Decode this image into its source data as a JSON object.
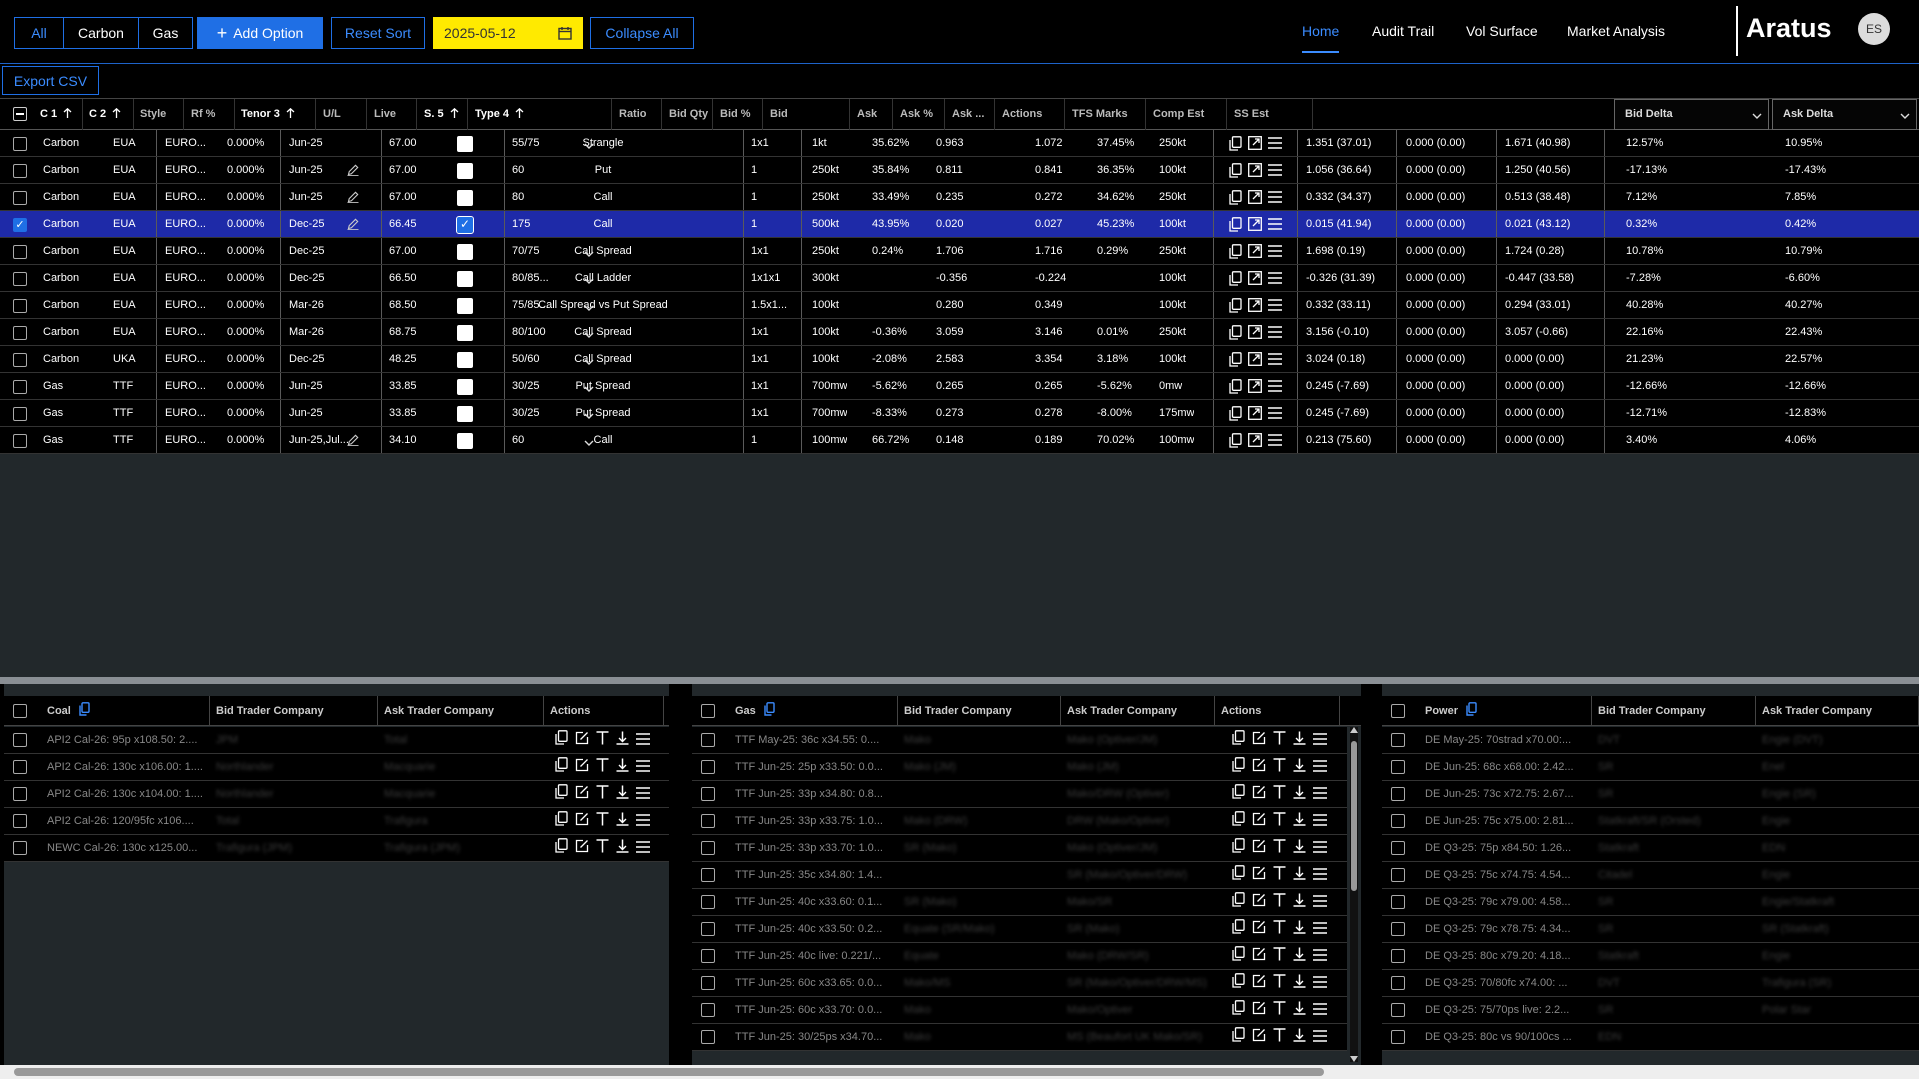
{
  "filters": {
    "all": "All",
    "carbon": "Carbon",
    "gas": "Gas"
  },
  "toolbar": {
    "add_option": "Add Option",
    "reset_sort": "Reset Sort",
    "date": "2025-05-12",
    "collapse_all": "Collapse All",
    "export_csv": "Export CSV"
  },
  "nav": {
    "home": "Home",
    "audit_trail": "Audit Trail",
    "vol_surface": "Vol Surface",
    "market_analysis": "Market Analysis"
  },
  "brand": "Aratus",
  "avatar": "ES",
  "colors": {
    "accent": "#1f6fe5",
    "date_bg": "#ffea00",
    "selected_row": "#1e2aa8"
  },
  "icons": {
    "plus": "plus-icon",
    "calendar": "calendar-icon",
    "sort_up": "arrow-up-icon",
    "chevron": "chevron-down-icon",
    "pencil": "pencil-icon",
    "copy": "copy-icon",
    "expand": "expand-icon",
    "menu": "menu-icon",
    "edit": "edit-icon",
    "top": "align-top-icon",
    "download": "download-icon"
  },
  "grid": {
    "headers": {
      "c1": "C 1",
      "c2": "C 2",
      "style": "Style",
      "rf": "Rf %",
      "tenor": "Tenor 3",
      "ul": "U/L",
      "live": "Live",
      "s": "S. 5",
      "type": "Type 4",
      "ratio": "Ratio",
      "bid_qty": "Bid Qty",
      "bid_pct": "Bid %",
      "bid": "Bid",
      "ask": "Ask",
      "ask_pct": "Ask %",
      "ask_qty": "Ask ...",
      "actions": "Actions",
      "tfs": "TFS Marks",
      "comp": "Comp Est",
      "ss": "SS Est",
      "bid_delta": "Bid Delta",
      "ask_delta": "Ask Delta"
    },
    "rows": [
      {
        "selected": false,
        "c1": "Carbon",
        "c2": "EUA",
        "style": "EURO...",
        "rf": "0.000%",
        "tenor": "Jun-25",
        "edit": false,
        "ul": "67.00",
        "live": false,
        "s": "55/75",
        "chev": true,
        "type": "Strangle",
        "ratio": "1x1",
        "bid_qty": "1kt",
        "bid_pct": "35.62%",
        "bid": "0.963",
        "ask": "1.072",
        "ask_pct": "37.45%",
        "ask_qty": "250kt",
        "tfs": "1.351 (37.01)",
        "comp": "0.000 (0.00)",
        "ss": "1.671 (40.98)",
        "bid_delta": "12.57%",
        "ask_delta": "10.95%"
      },
      {
        "selected": false,
        "c1": "Carbon",
        "c2": "EUA",
        "style": "EURO...",
        "rf": "0.000%",
        "tenor": "Jun-25",
        "edit": true,
        "ul": "67.00",
        "live": false,
        "s": "60",
        "chev": false,
        "type": "Put",
        "ratio": "1",
        "bid_qty": "250kt",
        "bid_pct": "35.84%",
        "bid": "0.811",
        "ask": "0.841",
        "ask_pct": "36.35%",
        "ask_qty": "100kt",
        "tfs": "1.056 (36.64)",
        "comp": "0.000 (0.00)",
        "ss": "1.250 (40.56)",
        "bid_delta": "-17.13%",
        "ask_delta": "-17.43%"
      },
      {
        "selected": false,
        "c1": "Carbon",
        "c2": "EUA",
        "style": "EURO...",
        "rf": "0.000%",
        "tenor": "Jun-25",
        "edit": true,
        "ul": "67.00",
        "live": false,
        "s": "80",
        "chev": false,
        "type": "Call",
        "ratio": "1",
        "bid_qty": "250kt",
        "bid_pct": "33.49%",
        "bid": "0.235",
        "ask": "0.272",
        "ask_pct": "34.62%",
        "ask_qty": "250kt",
        "tfs": "0.332 (34.37)",
        "comp": "0.000 (0.00)",
        "ss": "0.513 (38.48)",
        "bid_delta": "7.12%",
        "ask_delta": "7.85%"
      },
      {
        "selected": true,
        "c1": "Carbon",
        "c2": "EUA",
        "style": "EURO...",
        "rf": "0.000%",
        "tenor": "Dec-25",
        "edit": true,
        "ul": "66.45",
        "live": true,
        "s": "175",
        "chev": false,
        "type": "Call",
        "ratio": "1",
        "bid_qty": "500kt",
        "bid_pct": "43.95%",
        "bid": "0.020",
        "ask": "0.027",
        "ask_pct": "45.23%",
        "ask_qty": "100kt",
        "tfs": "0.015 (41.94)",
        "comp": "0.000 (0.00)",
        "ss": "0.021 (43.12)",
        "bid_delta": "0.32%",
        "ask_delta": "0.42%"
      },
      {
        "selected": false,
        "c1": "Carbon",
        "c2": "EUA",
        "style": "EURO...",
        "rf": "0.000%",
        "tenor": "Dec-25",
        "edit": false,
        "ul": "67.00",
        "live": false,
        "s": "70/75",
        "chev": true,
        "type": "Call Spread",
        "ratio": "1x1",
        "bid_qty": "250kt",
        "bid_pct": "0.24%",
        "bid": "1.706",
        "ask": "1.716",
        "ask_pct": "0.29%",
        "ask_qty": "250kt",
        "tfs": "1.698 (0.19)",
        "comp": "0.000 (0.00)",
        "ss": "1.724 (0.28)",
        "bid_delta": "10.78%",
        "ask_delta": "10.79%"
      },
      {
        "selected": false,
        "c1": "Carbon",
        "c2": "EUA",
        "style": "EURO...",
        "rf": "0.000%",
        "tenor": "Dec-25",
        "edit": false,
        "ul": "66.50",
        "live": false,
        "s": "80/85...",
        "chev": true,
        "type": "Call Ladder",
        "ratio": "1x1x1",
        "bid_qty": "300kt",
        "bid_pct": "",
        "bid": "-0.356",
        "ask": "-0.224",
        "ask_pct": "",
        "ask_qty": "100kt",
        "tfs": "-0.326 (31.39)",
        "comp": "0.000 (0.00)",
        "ss": "-0.447 (33.58)",
        "bid_delta": "-7.28%",
        "ask_delta": "-6.60%"
      },
      {
        "selected": false,
        "c1": "Carbon",
        "c2": "EUA",
        "style": "EURO...",
        "rf": "0.000%",
        "tenor": "Mar-26",
        "edit": false,
        "ul": "68.50",
        "live": false,
        "s": "75/85...",
        "chev": true,
        "type": "Call Spread vs Put Spread",
        "ratio": "1.5x1...",
        "bid_qty": "100kt",
        "bid_pct": "",
        "bid": "0.280",
        "ask": "0.349",
        "ask_pct": "",
        "ask_qty": "100kt",
        "tfs": "0.332 (33.11)",
        "comp": "0.000 (0.00)",
        "ss": "0.294 (33.01)",
        "bid_delta": "40.28%",
        "ask_delta": "40.27%"
      },
      {
        "selected": false,
        "c1": "Carbon",
        "c2": "EUA",
        "style": "EURO...",
        "rf": "0.000%",
        "tenor": "Mar-26",
        "edit": false,
        "ul": "68.75",
        "live": false,
        "s": "80/100",
        "chev": true,
        "type": "Call Spread",
        "ratio": "1x1",
        "bid_qty": "100kt",
        "bid_pct": "-0.36%",
        "bid": "3.059",
        "ask": "3.146",
        "ask_pct": "0.01%",
        "ask_qty": "250kt",
        "tfs": "3.156 (-0.10)",
        "comp": "0.000 (0.00)",
        "ss": "3.057 (-0.66)",
        "bid_delta": "22.16%",
        "ask_delta": "22.43%"
      },
      {
        "selected": false,
        "c1": "Carbon",
        "c2": "UKA",
        "style": "EURO...",
        "rf": "0.000%",
        "tenor": "Dec-25",
        "edit": false,
        "ul": "48.25",
        "live": false,
        "s": "50/60",
        "chev": true,
        "type": "Call Spread",
        "ratio": "1x1",
        "bid_qty": "100kt",
        "bid_pct": "-2.08%",
        "bid": "2.583",
        "ask": "3.354",
        "ask_pct": "3.18%",
        "ask_qty": "100kt",
        "tfs": "3.024 (0.18)",
        "comp": "0.000 (0.00)",
        "ss": "0.000 (0.00)",
        "bid_delta": "21.23%",
        "ask_delta": "22.57%"
      },
      {
        "selected": false,
        "c1": "Gas",
        "c2": "TTF",
        "style": "EURO...",
        "rf": "0.000%",
        "tenor": "Jun-25",
        "edit": false,
        "ul": "33.85",
        "live": false,
        "s": "30/25",
        "chev": true,
        "type": "Put Spread",
        "ratio": "1x1",
        "bid_qty": "700mw",
        "bid_pct": "-5.62%",
        "bid": "0.265",
        "ask": "0.265",
        "ask_pct": "-5.62%",
        "ask_qty": "0mw",
        "tfs": "0.245 (-7.69)",
        "comp": "0.000 (0.00)",
        "ss": "0.000 (0.00)",
        "bid_delta": "-12.66%",
        "ask_delta": "-12.66%"
      },
      {
        "selected": false,
        "c1": "Gas",
        "c2": "TTF",
        "style": "EURO...",
        "rf": "0.000%",
        "tenor": "Jun-25",
        "edit": false,
        "ul": "33.85",
        "live": false,
        "s": "30/25",
        "chev": true,
        "type": "Put Spread",
        "ratio": "1x1",
        "bid_qty": "700mw",
        "bid_pct": "-8.33%",
        "bid": "0.273",
        "ask": "0.278",
        "ask_pct": "-8.00%",
        "ask_qty": "175mw",
        "tfs": "0.245 (-7.69)",
        "comp": "0.000 (0.00)",
        "ss": "0.000 (0.00)",
        "bid_delta": "-12.71%",
        "ask_delta": "-12.83%"
      },
      {
        "selected": false,
        "c1": "Gas",
        "c2": "TTF",
        "style": "EURO...",
        "rf": "0.000%",
        "tenor": "Jun-25,Jul...",
        "edit": true,
        "ul": "34.10",
        "live": false,
        "s": "60",
        "chev": true,
        "type": "Call",
        "ratio": "1",
        "bid_qty": "100mw",
        "bid_pct": "66.72%",
        "bid": "0.148",
        "ask": "0.189",
        "ask_pct": "70.02%",
        "ask_qty": "100mw",
        "tfs": "0.213 (75.60)",
        "comp": "0.000 (0.00)",
        "ss": "0.000 (0.00)",
        "bid_delta": "3.40%",
        "ask_delta": "4.06%"
      }
    ]
  },
  "panels": {
    "coal": {
      "title": "Coal",
      "bid_header": "Bid Trader Company",
      "ask_header": "Ask Trader Company",
      "actions_header": "Actions",
      "rows": [
        {
          "desc": "API2 Cal-26: 95p x108.50: 2....",
          "bid": "JPM",
          "ask": "Total"
        },
        {
          "desc": "API2 Cal-26: 130c x106.00: 1....",
          "bid": "Northlander",
          "ask": "Macquarie"
        },
        {
          "desc": "API2 Cal-26: 130c x104.00: 1....",
          "bid": "Northlander",
          "ask": "Macquarie"
        },
        {
          "desc": "API2 Cal-26: 120/95fc x106....",
          "bid": "Total",
          "ask": "Trafigura"
        },
        {
          "desc": "NEWC Cal-26: 130c x125.00...",
          "bid": "Trafigura (JPM)",
          "ask": "Trafigura (JPM)"
        }
      ]
    },
    "gas": {
      "title": "Gas",
      "bid_header": "Bid Trader Company",
      "ask_header": "Ask Trader Company",
      "actions_header": "Actions",
      "rows": [
        {
          "desc": "TTF May-25: 36c x34.55: 0....",
          "bid": "Mako",
          "ask": "Mako (Optiver/JM)"
        },
        {
          "desc": "TTF Jun-25: 25p x33.50: 0.0...",
          "bid": "Mako (JM)",
          "ask": "Mako (JM)"
        },
        {
          "desc": "TTF Jun-25: 33p x34.80: 0.8...",
          "bid": "",
          "ask": "Mako/DRW (Optiver)"
        },
        {
          "desc": "TTF Jun-25: 33p x33.75: 1.0...",
          "bid": "Mako (DRW)",
          "ask": "DRW (Mako/Optiver)"
        },
        {
          "desc": "TTF Jun-25: 33p x33.70: 1.0...",
          "bid": "SR (Mako)",
          "ask": "Mako (Optiver/JM)"
        },
        {
          "desc": "TTF Jun-25: 35c x34.80: 1.4...",
          "bid": "",
          "ask": "SR (Mako/Optiver/DRW)"
        },
        {
          "desc": "TTF Jun-25: 40c x33.60: 0.1...",
          "bid": "SR (Mako)",
          "ask": "Mako/SR"
        },
        {
          "desc": "TTF Jun-25: 40c x33.50: 0.2...",
          "bid": "Equate (SR/Mako)",
          "ask": "SR (Mako)"
        },
        {
          "desc": "TTF Jun-25: 40c live: 0.221/...",
          "bid": "Equate",
          "ask": "Mako (DRW/SR)"
        },
        {
          "desc": "TTF Jun-25: 60c x33.65: 0.0...",
          "bid": "Mako/MS",
          "ask": "SR (Mako/Optiver/DRW/MS)"
        },
        {
          "desc": "TTF Jun-25: 60c x33.70: 0.0...",
          "bid": "Mako",
          "ask": "Mako/Optiver"
        },
        {
          "desc": "TTF Jun-25: 30/25ps x34.70...",
          "bid": "Mako",
          "ask": "MS (Beaufort UK Mako/SR)"
        }
      ]
    },
    "power": {
      "title": "Power",
      "bid_header": "Bid Trader Company",
      "ask_header": "Ask Trader Company",
      "rows": [
        {
          "desc": "DE May-25: 70strad x70.00:...",
          "bid": "DVT",
          "ask": "Engie (DVT)"
        },
        {
          "desc": "DE Jun-25: 68c x68.00: 2.42...",
          "bid": "SR",
          "ask": "Enel"
        },
        {
          "desc": "DE Jun-25: 73c x72.75: 2.67...",
          "bid": "SR",
          "ask": "Engie (SR)"
        },
        {
          "desc": "DE Jun-25: 75c x75.00: 2.81...",
          "bid": "Statkraft/SR (Orsted)",
          "ask": "Engie"
        },
        {
          "desc": "DE Q3-25: 75p x84.50: 1.26...",
          "bid": "Statkraft",
          "ask": "EDN"
        },
        {
          "desc": "DE Q3-25: 75c x74.75: 4.54...",
          "bid": "Citadel",
          "ask": "Engie"
        },
        {
          "desc": "DE Q3-25: 79c x79.00: 4.58...",
          "bid": "SR",
          "ask": "Engie/Statkraft"
        },
        {
          "desc": "DE Q3-25: 79c x78.75: 4.34...",
          "bid": "SR",
          "ask": "SR (Statkraft)"
        },
        {
          "desc": "DE Q3-25: 80c x79.20: 4.18...",
          "bid": "Statkraft",
          "ask": "Engie"
        },
        {
          "desc": "DE Q3-25: 70/80fc x74.00: ...",
          "bid": "DVT",
          "ask": "Trafigura (SR)"
        },
        {
          "desc": "DE Q3-25: 75/70ps live: 2.2...",
          "bid": "SR",
          "ask": "Polar Star"
        },
        {
          "desc": "DE Q3-25: 80c vs 90/100cs ...",
          "bid": "EDN",
          "ask": ""
        }
      ]
    }
  }
}
